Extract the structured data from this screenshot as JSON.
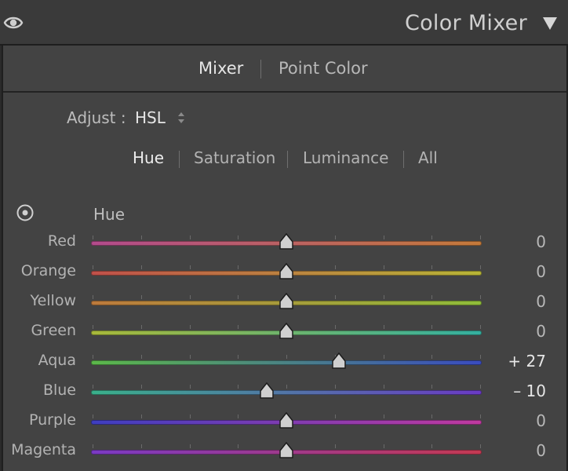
{
  "header": {
    "title": "Color Mixer",
    "visibility_icon": "eye-icon",
    "collapse_icon": "triangle-down-icon"
  },
  "modes": {
    "mixer": "Mixer",
    "point_color": "Point Color",
    "active": "Mixer"
  },
  "adjust": {
    "label": "Adjust :",
    "value": "HSL",
    "icon": "up-down-arrows-icon"
  },
  "tabs": [
    {
      "label": "Hue",
      "active": true
    },
    {
      "label": "Saturation",
      "active": false
    },
    {
      "label": "Luminance",
      "active": false
    },
    {
      "label": "All",
      "active": false
    }
  ],
  "section": {
    "label": "Hue",
    "target_icon": "target-adjust-icon"
  },
  "slider_range": [
    -100,
    100
  ],
  "sliders": [
    {
      "label": "Red",
      "value": 0,
      "display": "0",
      "colors": [
        "#b24b8c",
        "#c47a3a"
      ]
    },
    {
      "label": "Orange",
      "value": 0,
      "display": "0",
      "colors": [
        "#c0504a",
        "#b7b536"
      ]
    },
    {
      "label": "Yellow",
      "value": 0,
      "display": "0",
      "colors": [
        "#bd7a3c",
        "#8fbd3a"
      ]
    },
    {
      "label": "Green",
      "value": 0,
      "display": "0",
      "colors": [
        "#a8b83a",
        "#34b0a0"
      ]
    },
    {
      "label": "Aqua",
      "value": 27,
      "display": "+ 27",
      "colors": [
        "#5cb84a",
        "#3a4cc0"
      ]
    },
    {
      "label": "Blue",
      "value": -10,
      "display": "– 10",
      "colors": [
        "#3ab08a",
        "#6a3ac4"
      ]
    },
    {
      "label": "Purple",
      "value": 0,
      "display": "0",
      "colors": [
        "#3e3ec0",
        "#c03aa0"
      ]
    },
    {
      "label": "Magenta",
      "value": 0,
      "display": "0",
      "colors": [
        "#7a3ac4",
        "#c43a52"
      ]
    }
  ]
}
